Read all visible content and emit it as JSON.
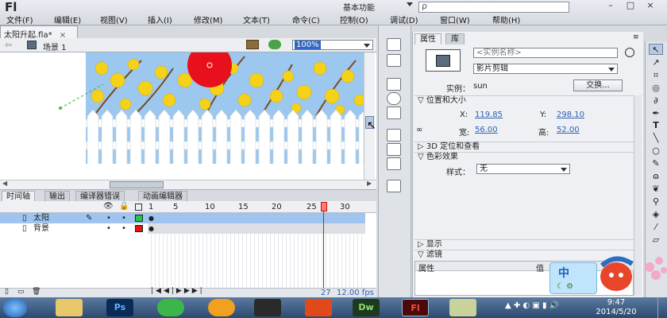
{
  "app": {
    "logo": "Fl",
    "workspace": "基本功能",
    "search_placeholder": "ρ",
    "menus": [
      "文件(F)",
      "编辑(E)",
      "视图(V)",
      "插入(I)",
      "修改(M)",
      "文本(T)",
      "命令(C)",
      "控制(O)",
      "调试(D)",
      "窗口(W)",
      "帮助(H)"
    ]
  },
  "document": {
    "tab_name": "太阳升起.fla*",
    "tab_close": "×",
    "scene": "场景 1",
    "zoom": "100%"
  },
  "timeline": {
    "tabs": [
      "时间轴",
      "输出",
      "编译器错误",
      "动画编辑器"
    ],
    "frame_numbers": [
      "1",
      "5",
      "10",
      "15",
      "20",
      "25",
      "30"
    ],
    "layers": [
      {
        "name": "太阳",
        "selected": true,
        "color": "#27c44a"
      },
      {
        "name": "背景",
        "selected": false,
        "color": "#e01414"
      }
    ],
    "current_frame": "27",
    "fps": "12.00 fps"
  },
  "properties": {
    "tab_props": "属性",
    "tab_library": "库",
    "instance_name_placeholder": "<实例名称>",
    "symbol_type": "影片剪辑",
    "instance_label": "实例：",
    "instance_value": "sun",
    "swap_button": "交换...",
    "section_position": "位置和大小",
    "x_label": "X:",
    "x_value": "119.85",
    "y_label": "Y:",
    "y_value": "298.10",
    "w_label": "宽:",
    "w_value": "56.00",
    "h_label": "高:",
    "h_value": "52.00",
    "section_3d": "3D 定位和查看",
    "section_color": "色彩效果",
    "style_label": "样式：",
    "style_value": "无",
    "section_display": "显示",
    "section_filter": "滤镜",
    "filter_col_prop": "属性",
    "filter_col_val": "值"
  },
  "ime": {
    "label": "中"
  },
  "taskbar": {
    "apps": [
      "Ps",
      "Dw",
      "Fl"
    ],
    "time": "9:47",
    "date": "2014/5/20"
  },
  "colors": {
    "accent": "#2d5fb6",
    "selected_layer": "#9ec4ef",
    "playhead": "#e01414",
    "sky": "#9cc7ee",
    "sun": "#e8101c",
    "flower": "#f5d21a"
  }
}
